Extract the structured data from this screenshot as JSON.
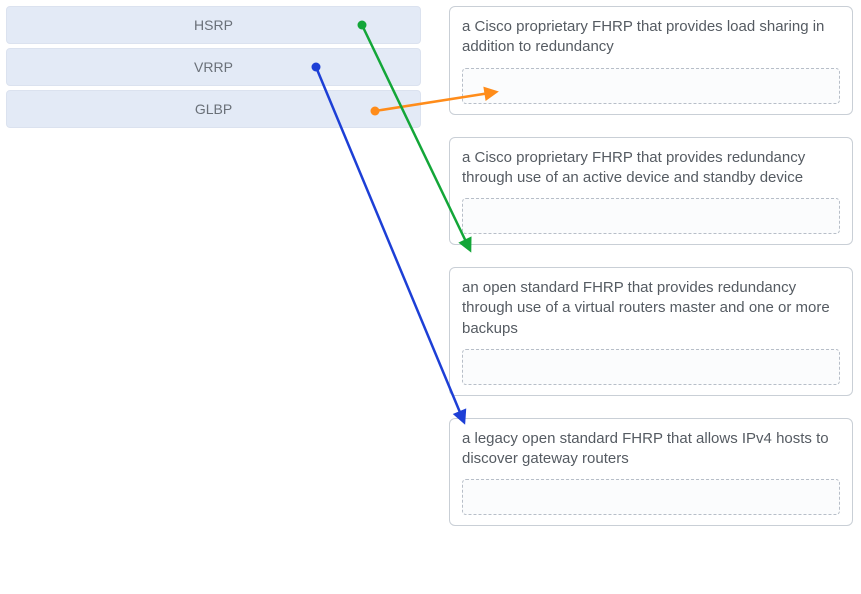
{
  "left_items": [
    {
      "label": "HSRP"
    },
    {
      "label": "VRRP"
    },
    {
      "label": "GLBP"
    }
  ],
  "right_cards": [
    {
      "desc": "a Cisco proprietary FHRP that provides load sharing in addition to redundancy"
    },
    {
      "desc": "a Cisco proprietary FHRP that provides redundancy through use of an active device and standby device"
    },
    {
      "desc": "an open standard FHRP that provides redundancy through use of a virtual routers master and one or more backups"
    },
    {
      "desc": "a legacy open standard FHRP that allows IPv4 hosts to discover gateway routers"
    }
  ],
  "arrows": [
    {
      "color": "#ff8c1a",
      "from": "GLBP",
      "to_card_index": 0
    },
    {
      "color": "#13a638",
      "from": "HSRP",
      "to_card_index": 1
    },
    {
      "color": "#1d3fd6",
      "from": "VRRP",
      "to_card_index": 2
    }
  ]
}
